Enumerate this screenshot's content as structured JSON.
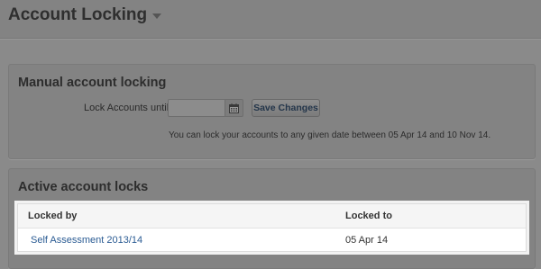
{
  "header": {
    "title": "Account Locking"
  },
  "manual": {
    "title": "Manual account locking",
    "lock_label": "Lock Accounts until",
    "date_value": "",
    "date_placeholder": "",
    "save_label": "Save Changes",
    "help_text": "You can lock your accounts to any given date between 05 Apr 14 and 10 Nov 14."
  },
  "active": {
    "title": "Active account locks",
    "columns": [
      "Locked by",
      "Locked to"
    ],
    "rows": [
      {
        "locked_by": "Self Assessment 2013/14",
        "locked_to": "05 Apr 14"
      }
    ]
  },
  "icons": {
    "calendar": "calendar-icon",
    "title_dropdown": "chevron-down-icon"
  },
  "colors": {
    "overlay": "#8a8a8a",
    "link": "#2a5b93",
    "table_bg": "#ffffff"
  }
}
